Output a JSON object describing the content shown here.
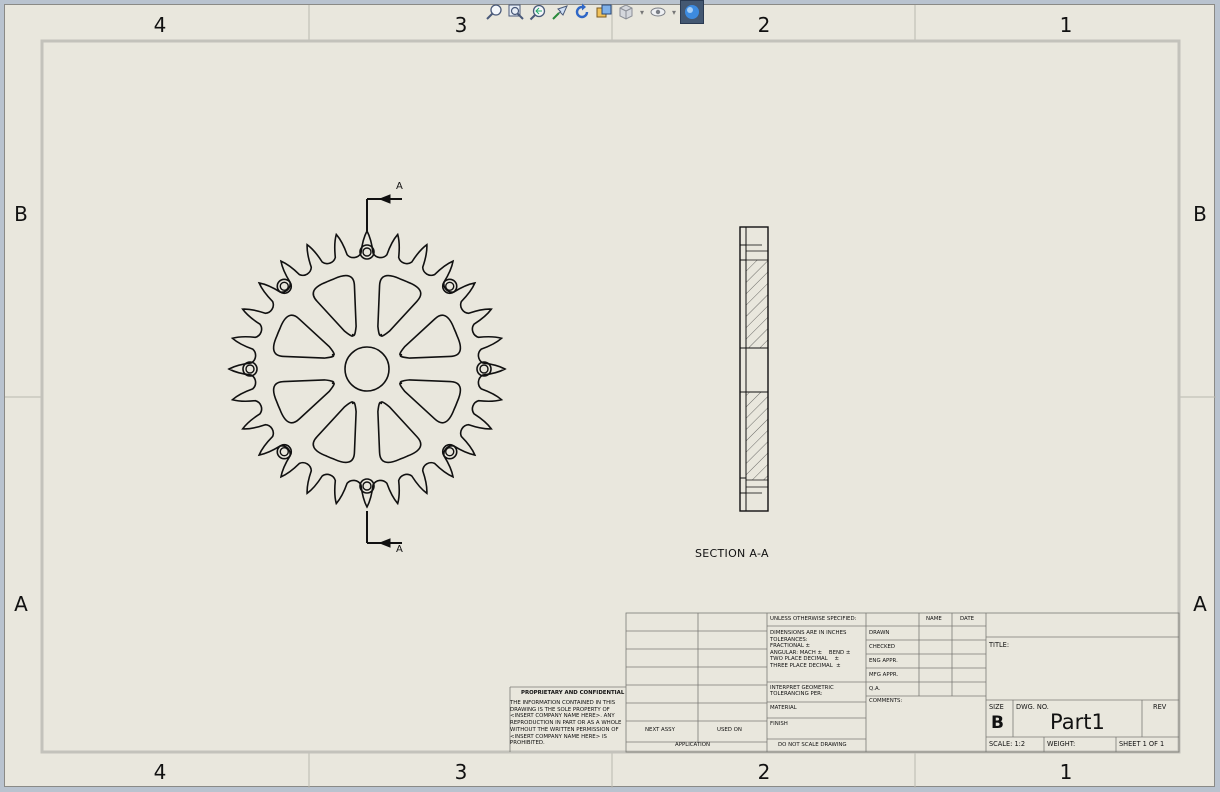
{
  "zones": {
    "columns": [
      "4",
      "3",
      "2",
      "1"
    ],
    "rows": [
      "B",
      "A"
    ]
  },
  "toolbar": {
    "icons": [
      "zoom-to-fit-icon",
      "zoom-to-area-icon",
      "zoom-previous-icon",
      "select-icon",
      "rotate-icon",
      "view-orientation-icon",
      "display-style-icon",
      "hide-show-icon",
      "appearance-icon"
    ]
  },
  "view": {
    "section_arrow_top": "A",
    "section_arrow_bottom": "A",
    "section_label": "SECTION A-A"
  },
  "title_block": {
    "proprietary_title": "PROPRIETARY AND CONFIDENTIAL",
    "proprietary_text": "THE INFORMATION CONTAINED IN THIS\nDRAWING IS THE SOLE PROPERTY OF\n<INSERT COMPANY NAME HERE>. ANY\nREPRODUCTION IN PART OR AS A WHOLE\nWITHOUT THE WRITTEN PERMISSION OF\n<INSERT COMPANY NAME HERE> IS\nPROHIBITED.",
    "next_assy": "NEXT ASSY",
    "used_on": "USED ON",
    "application": "APPLICATION",
    "unless": "UNLESS OTHERWISE SPECIFIED:",
    "dims": "DIMENSIONS ARE IN INCHES\nTOLERANCES:\nFRACTIONAL ±\nANGULAR: MACH ±    BEND ±\nTWO PLACE DECIMAL    ±\nTHREE PLACE DECIMAL  ±",
    "interpret": "INTERPRET GEOMETRIC\nTOLERANCING PER:",
    "material": "MATERIAL",
    "finish": "FINISH",
    "do_not_scale": "DO NOT SCALE DRAWING",
    "name_col": "NAME",
    "date_col": "DATE",
    "drawn": "DRAWN",
    "checked": "CHECKED",
    "eng_appr": "ENG APPR.",
    "mfg_appr": "MFG APPR.",
    "qa": "Q.A.",
    "comments": "COMMENTS:",
    "title_label": "TITLE:",
    "size_label": "SIZE",
    "size_value": "B",
    "dwg_no_label": "DWG.  NO.",
    "dwg_no_value": "Part1",
    "rev_label": "REV",
    "scale": "SCALE: 1:2",
    "weight": "WEIGHT:",
    "sheet": "SHEET 1 OF 1"
  }
}
